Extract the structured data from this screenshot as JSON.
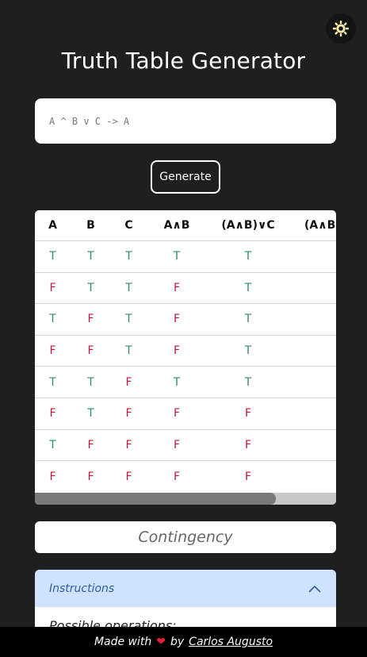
{
  "header": {
    "title": "Truth Table Generator",
    "theme_icon": "gear-icon"
  },
  "input": {
    "placeholder": "A ^ B v C -> A",
    "value": ""
  },
  "generate_label": "Generate",
  "table": {
    "headers": [
      "A",
      "B",
      "C",
      "A∧B",
      "(A∧B)∨C",
      "(A∧B"
    ],
    "rows": [
      [
        "T",
        "T",
        "T",
        "T",
        "T"
      ],
      [
        "F",
        "T",
        "T",
        "F",
        "T"
      ],
      [
        "T",
        "F",
        "T",
        "F",
        "T"
      ],
      [
        "F",
        "F",
        "T",
        "F",
        "T"
      ],
      [
        "T",
        "T",
        "F",
        "T",
        "T"
      ],
      [
        "F",
        "T",
        "F",
        "F",
        "F"
      ],
      [
        "T",
        "F",
        "F",
        "F",
        "F"
      ],
      [
        "F",
        "F",
        "F",
        "F",
        "F"
      ]
    ],
    "scroll_fraction": 0.8
  },
  "result": "Contingency",
  "instructions": {
    "title": "Instructions",
    "body_partial": "Possible operations:"
  },
  "footer": {
    "made_with": "Made with",
    "heart": "❤",
    "by": "by",
    "author": "Carlos Augusto"
  },
  "colors": {
    "true": "#2e8b73",
    "false": "#c2183a",
    "background": "#1f1f1f",
    "accordion_head": "#cfe2ff"
  }
}
